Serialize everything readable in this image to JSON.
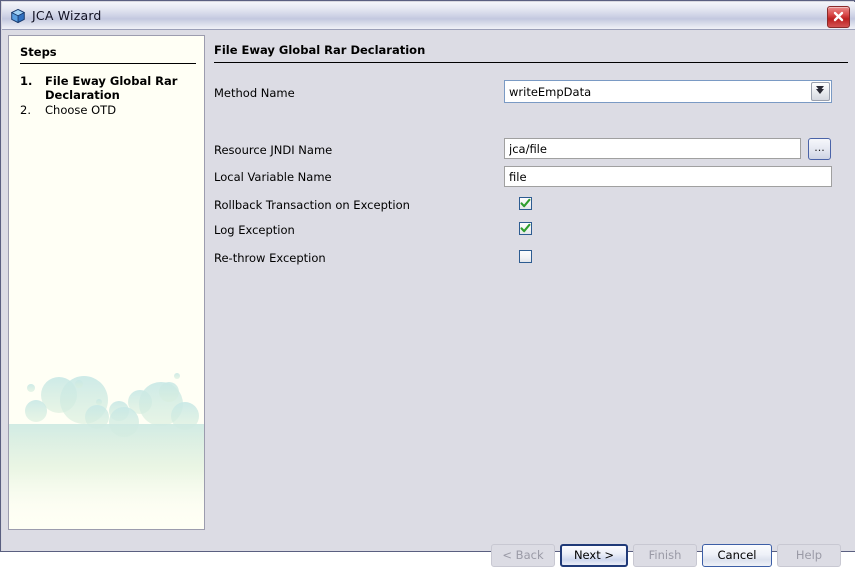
{
  "window": {
    "title": "JCA Wizard",
    "icon": "cube-icon",
    "close_label": "Close",
    "close_icon": "close-icon"
  },
  "sidebar": {
    "heading": "Steps",
    "steps": [
      {
        "number": "1.",
        "label": "File Eway Global Rar Declaration",
        "current": true
      },
      {
        "number": "2.",
        "label": "Choose OTD",
        "current": false
      }
    ]
  },
  "main": {
    "title": "File Eway Global Rar Declaration",
    "fields": [
      {
        "label": "Method Name",
        "type": "combobox",
        "value": "writeEmpData",
        "placeholder": "",
        "focused": true,
        "dropdown_icon": "chevron-down-icon"
      },
      {
        "label": "Resource JNDI Name",
        "type": "text-with-browse",
        "value": "jca/file",
        "placeholder": "",
        "browse_label": "...",
        "browse_icon": "ellipsis-icon"
      },
      {
        "label": "Local Variable Name",
        "type": "text",
        "value": "file",
        "placeholder": ""
      },
      {
        "label": "Rollback Transaction on Exception",
        "type": "checkbox",
        "checked": true
      },
      {
        "label": "Log Exception",
        "type": "checkbox",
        "checked": true
      },
      {
        "label": "Re-throw Exception",
        "type": "checkbox",
        "checked": false
      }
    ]
  },
  "footer": {
    "buttons": [
      {
        "label": "< Back",
        "state": "disabled",
        "mnemonic": "B"
      },
      {
        "label": "Next >",
        "state": "default",
        "mnemonic": "N"
      },
      {
        "label": "Finish",
        "state": "disabled",
        "mnemonic": "F"
      },
      {
        "label": "Cancel",
        "state": "normal",
        "mnemonic": ""
      },
      {
        "label": "Help",
        "state": "disabled",
        "mnemonic": "H"
      }
    ]
  },
  "colors": {
    "dialog_background": "#dcdce4",
    "sidebar_background": "#fffff5",
    "field_background": "#ffffff",
    "checkbox_border": "#2d5c91",
    "checkbox_check": "#2f9e2f",
    "default_button_border": "#203a78",
    "close_button": "#bc2020",
    "titlebar_from": "#f4f5fa",
    "titlebar_to": "#c3c8df",
    "decor_bubble": "#cfe8e6"
  }
}
